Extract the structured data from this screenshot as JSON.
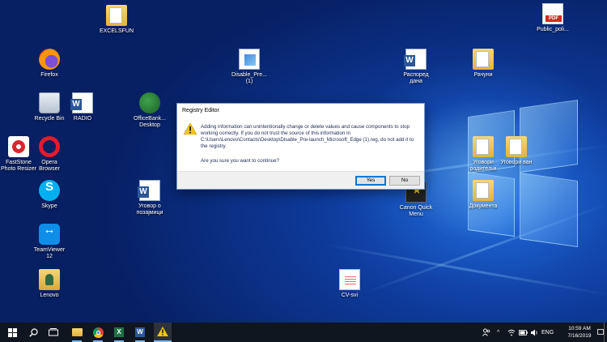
{
  "desktop_icons": [
    {
      "name": "EXCELSFUN",
      "glyph": "folder-icon"
    },
    {
      "name": "Public_poli...",
      "glyph": "pdf-icon"
    },
    {
      "name": "Firefox",
      "glyph": "firefox-icon"
    },
    {
      "name": "Disable_Pre...\n(1)",
      "glyph": "registry-file-icon"
    },
    {
      "name": "Распоред\nдана",
      "glyph": "word-doc-icon"
    },
    {
      "name": "Рачуни",
      "glyph": "folder-icon"
    },
    {
      "name": "Recycle Bin",
      "glyph": "recycle-bin-icon"
    },
    {
      "name": "RADIO",
      "glyph": "word-doc-icon"
    },
    {
      "name": "OfficeBank...\nDesktop",
      "glyph": "officebank-icon"
    },
    {
      "name": "FastStone\nPhoto Resizer",
      "glyph": "faststone-icon"
    },
    {
      "name": "Opera\nBrowser",
      "glyph": "opera-icon"
    },
    {
      "name": "Уговори\nродитељи",
      "glyph": "folder-icon"
    },
    {
      "name": "Уговори ван",
      "glyph": "folder-icon"
    },
    {
      "name": "Skype",
      "glyph": "skype-icon"
    },
    {
      "name": "Уговор о\nпозајмици",
      "glyph": "word-doc-icon"
    },
    {
      "name": "Canon Quick\nMenu",
      "glyph": "canon-icon"
    },
    {
      "name": "Документа",
      "glyph": "folder-icon"
    },
    {
      "name": "TeamViewer\n12",
      "glyph": "teamviewer-icon"
    },
    {
      "name": "Lenovo",
      "glyph": "lenovo-folder-icon"
    },
    {
      "name": "CV-svi",
      "glyph": "file-icon"
    }
  ],
  "dialog": {
    "title": "Registry Editor",
    "message": "Adding information can unintentionally change or delete values and cause components to stop working correctly. If you do not trust the source of this information in C:\\Users\\Lenovo\\Contacts\\Desktop\\Disable_Pre-launch_Microsoft_Edge (1).reg, do not add it to the registry.",
    "question": "Are you sure you want to continue?",
    "yes_label": "Yes",
    "no_label": "No",
    "icon": "warning-icon"
  },
  "taskbar": {
    "pinned": [
      "start-icon",
      "search-icon",
      "task-view-icon",
      "file-explorer-icon",
      "chrome-icon",
      "excel-icon",
      "word-icon",
      "registry-warning-icon"
    ],
    "tray": {
      "language": "ENG",
      "time": "10:59 AM",
      "date": "7/16/2019"
    }
  },
  "colors": {
    "accent": "#0078d7",
    "taskbar": "#10161f",
    "warning": "#f2c811"
  }
}
